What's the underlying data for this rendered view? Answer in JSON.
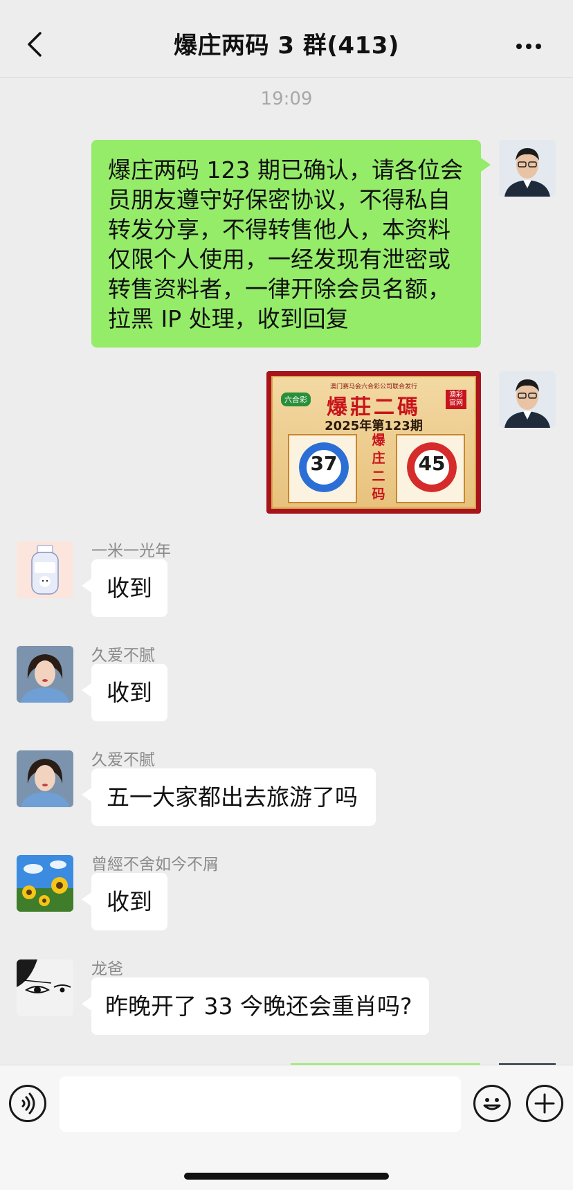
{
  "header": {
    "back_icon": "chevron-left-icon",
    "title": "爆庄两码 3 群(413)",
    "more_icon": "ellipsis-icon"
  },
  "timestamp": "19:09",
  "messages": [
    {
      "direction": "out",
      "sender": "",
      "type": "text",
      "text_lines": [
        "爆庄两码 123 期已确认，请各位会",
        "员朋友遵守好保密协议，不得私自",
        "转发分享，不得转售他人，本资料",
        "仅限个人使用，一经发现有泄密或",
        "转售资料者，一律开除会员名额，",
        "拉黑 IP 处理，收到回复"
      ]
    },
    {
      "direction": "out",
      "sender": "",
      "type": "image",
      "image": {
        "top_caption": "澳门赛马会六合彩公司联合发行",
        "brand": "六合彩",
        "name": "爆莊二碼",
        "official_badge": "澳彩官网",
        "period": "2025年第123期",
        "middle_text": "爆庄二码",
        "balls": [
          {
            "number": "37",
            "color": "#2b6fd6"
          },
          {
            "number": "45",
            "color": "#d62b2b"
          }
        ]
      }
    },
    {
      "direction": "in",
      "sender": "一米一光年",
      "type": "text",
      "text": "收到"
    },
    {
      "direction": "in",
      "sender": "久爱不腻",
      "type": "text",
      "text": "收到"
    },
    {
      "direction": "in",
      "sender": "久爱不腻",
      "type": "text",
      "text": "五一大家都出去旅游了吗"
    },
    {
      "direction": "in",
      "sender": "曾經不舍如今不屑",
      "type": "text",
      "text": "收到"
    },
    {
      "direction": "in",
      "sender": "龙爸",
      "type": "text",
      "text": "昨晚开了 33 今晚还会重肖吗?"
    }
  ],
  "input_bar": {
    "voice_icon": "voice-icon",
    "emoji_icon": "emoji-icon",
    "plus_icon": "plus-icon",
    "input_value": ""
  },
  "colors": {
    "background": "#ededed",
    "outgoing_bubble": "#95ec69",
    "incoming_bubble": "#ffffff"
  }
}
